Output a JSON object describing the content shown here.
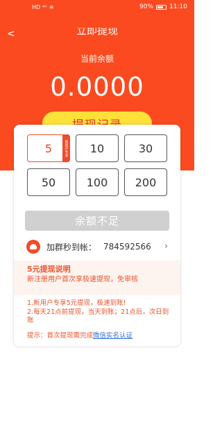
{
  "status": {
    "network": "HD ⁴ᴳ",
    "battery_pct": "90%",
    "time": "11:10"
  },
  "header": {
    "back": "<",
    "title": "立即提现",
    "balance_label": "当前余额",
    "balance": "0.0000",
    "record_button": "提现记录"
  },
  "amounts": [
    {
      "label": "5",
      "selected": true,
      "tag": "新用户专享"
    },
    {
      "label": "10"
    },
    {
      "label": "30"
    },
    {
      "label": "50"
    },
    {
      "label": "100"
    },
    {
      "label": "200"
    }
  ],
  "submit_button": "余额不足",
  "group": {
    "label": "加群秒到帐：",
    "number": "784592566"
  },
  "info": {
    "title": "5元提现说明",
    "text": "新注册用户首次享极速提现，免审核"
  },
  "rules": {
    "line1": "1.新用户专享5元提现，极速到账!",
    "line2": "2.每天21点前提现，当天到账；21点后，次日到账"
  },
  "tip": {
    "prefix": "提示：首次提现需完成",
    "link": "微信实名认证"
  },
  "colors": {
    "brand": "#fb4a1f",
    "accent_yellow": "#fde138",
    "highlight_text": "#e8542c",
    "link": "#2b6ed6"
  }
}
